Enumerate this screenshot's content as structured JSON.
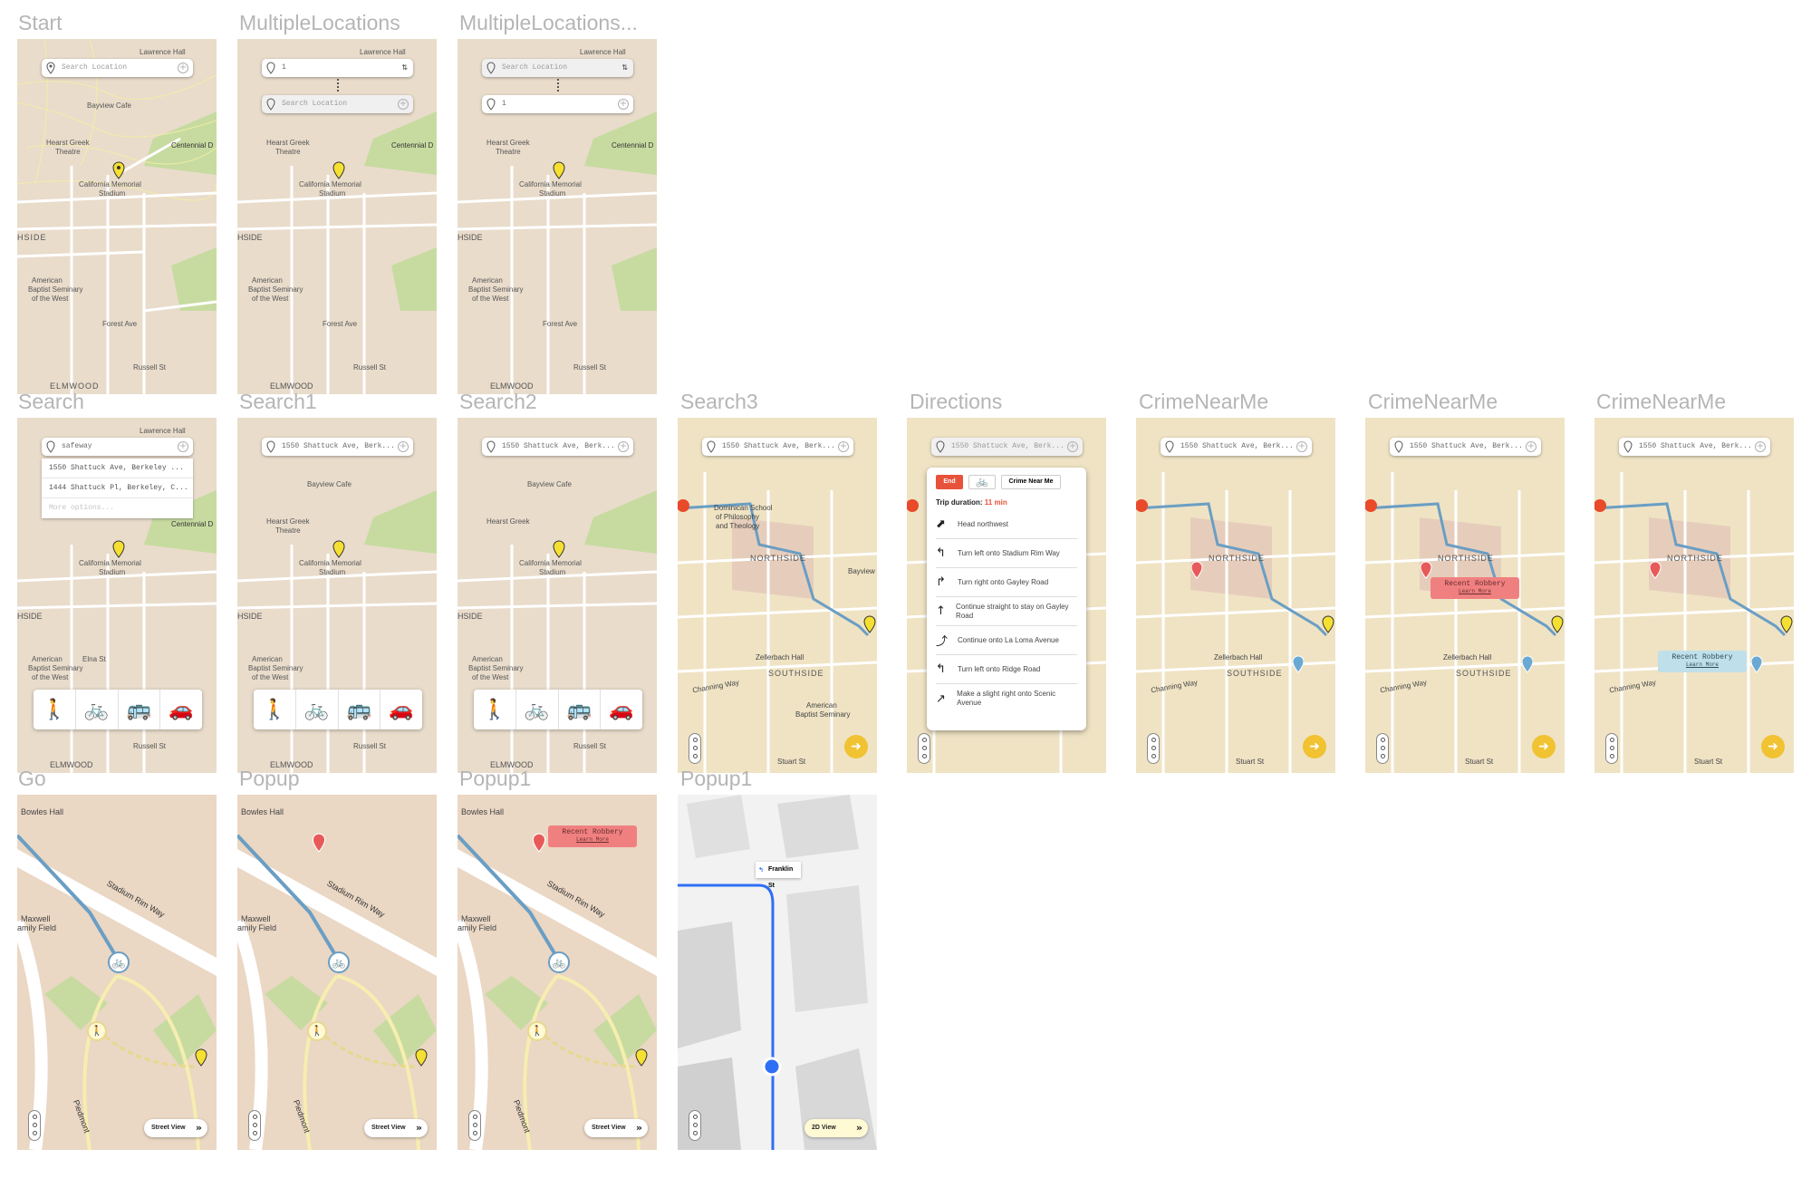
{
  "labels": {
    "start": "Start",
    "multi1": "MultipleLocations",
    "multi2": "MultipleLocations...",
    "search": "Search",
    "search1": "Search1",
    "search2": "Search2",
    "search3": "Search3",
    "directions": "Directions",
    "crime1": "CrimeNearMe",
    "crime2": "CrimeNearMe",
    "crime3": "CrimeNearMe",
    "go": "Go",
    "popup": "Popup",
    "popup1": "Popup1",
    "popup1b": "Popup1"
  },
  "search": {
    "placeholder": "Search Location",
    "typed_index": "1",
    "query": "safeway",
    "selected": "1550 Shattuck Ave, Berk...",
    "suggestions": [
      "1550 Shattuck Ave, Berkeley ...",
      "1444 Shattuck Pl, Berkeley, C...",
      "More options..."
    ]
  },
  "map_labels": {
    "lawrence_hall": "Lawrence Hall",
    "bayview_cafe": "Bayview Cafe",
    "hearst_greek": "Hearst Greek",
    "theatre": "Theatre",
    "centennial": "Centennial D",
    "cal_memorial": "California Memorial",
    "stadium": "Stadium",
    "hside": "HSIDE",
    "american": "American",
    "baptist": "Baptist Seminary",
    "of_the_west": "of the West",
    "elna": "Elna St",
    "forest": "Forest Ave",
    "russell": "Russell St",
    "elmwood": "ELMWOOD",
    "dominican": "Dominican School",
    "philosophy": "of Philosophy",
    "theology": "and Theology",
    "northside": "NORTHSIDE",
    "southside": "SOUTHSIDE",
    "zellerbach": "Zellerbach Hall",
    "bayview": "Bayview",
    "channing": "Channing Way",
    "stuart": "Stuart St",
    "bowles": "Bowles Hall",
    "stadium_rim": "Stadium Rim Way",
    "maxwell": "Maxwell",
    "family_field": "amily Field",
    "piedmont": "Piedmont",
    "franklin": "Franklin St"
  },
  "buttons": {
    "street_view": "Street View",
    "view_2d": "2D View",
    "end": "End",
    "crime_near_me": "Crime Near Me"
  },
  "directions": {
    "duration_label": "Trip duration:",
    "duration_value": "11 min",
    "steps": [
      {
        "icon": "head-northwest-icon",
        "text": "Head northwest"
      },
      {
        "icon": "turn-left-icon",
        "text": "Turn left onto Stadium Rim Way"
      },
      {
        "icon": "turn-right-icon",
        "text": "Turn right onto Gayley Road"
      },
      {
        "icon": "straight-icon",
        "text": "Continue straight to stay on Gayley Road"
      },
      {
        "icon": "continue-icon",
        "text": "Continue onto La Loma Avenue"
      },
      {
        "icon": "turn-left-icon",
        "text": "Turn left onto Ridge Road"
      },
      {
        "icon": "slight-right-icon",
        "text": "Make a slight right onto Scenic Avenue"
      }
    ]
  },
  "popup": {
    "title": "Recent Robbery",
    "link": "Learn More"
  },
  "colors": {
    "route": "#6a9ec4",
    "accent_yellow": "#f1c232",
    "alert_red": "#e8523a",
    "map_bg": "#e9dccb",
    "park": "#c7dba0"
  }
}
